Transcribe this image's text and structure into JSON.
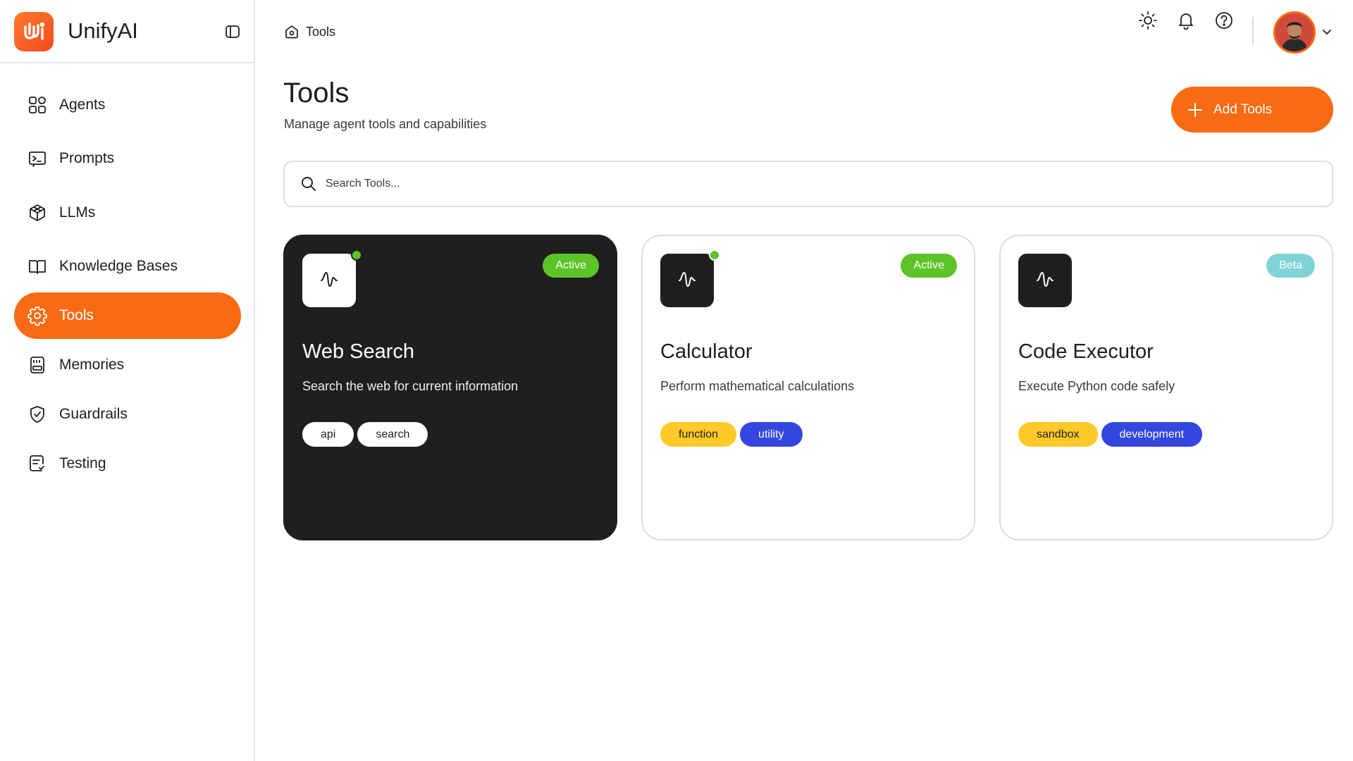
{
  "app": {
    "name": "UnifyAI"
  },
  "sidebar": {
    "items": [
      {
        "label": "Agents",
        "icon": "grid-icon",
        "active": false
      },
      {
        "label": "Prompts",
        "icon": "terminal-icon",
        "active": false
      },
      {
        "label": "LLMs",
        "icon": "cube-icon",
        "active": false
      },
      {
        "label": "Knowledge Bases",
        "icon": "book-icon",
        "active": false
      },
      {
        "label": "Tools",
        "icon": "cog-icon",
        "active": true
      },
      {
        "label": "Memories",
        "icon": "sd-card-icon",
        "active": false
      },
      {
        "label": "Guardrails",
        "icon": "shield-icon",
        "active": false
      },
      {
        "label": "Testing",
        "icon": "checklist-icon",
        "active": false
      }
    ]
  },
  "topbar": {
    "breadcrumb": "Tools",
    "icons": [
      "sun-icon",
      "bell-icon",
      "help-icon"
    ]
  },
  "page": {
    "title": "Tools",
    "subtitle": "Manage agent tools and capabilities",
    "add_button": "Add Tools"
  },
  "search": {
    "placeholder": "Search Tools..."
  },
  "cards": [
    {
      "title": "Web Search",
      "description": "Search the web for current information",
      "status": "Active",
      "online": true,
      "tags": [
        {
          "label": "api"
        },
        {
          "label": "search"
        }
      ]
    },
    {
      "title": "Calculator",
      "description": "Perform mathematical calculations",
      "status": "Active",
      "online": true,
      "tags": [
        {
          "label": "function"
        },
        {
          "label": "utility"
        }
      ]
    },
    {
      "title": "Code Executor",
      "description": "Execute Python code safely",
      "status": "Beta",
      "online": false,
      "tags": [
        {
          "label": "sandbox"
        },
        {
          "label": "development"
        }
      ]
    }
  ],
  "colors": {
    "accent": "#f86a14",
    "active_status": "#5cc427",
    "beta_status": "#7fd3d6",
    "tag_yellow": "#ffc929",
    "tag_blue": "#3346e0",
    "dark_card": "#1f1f1f"
  }
}
